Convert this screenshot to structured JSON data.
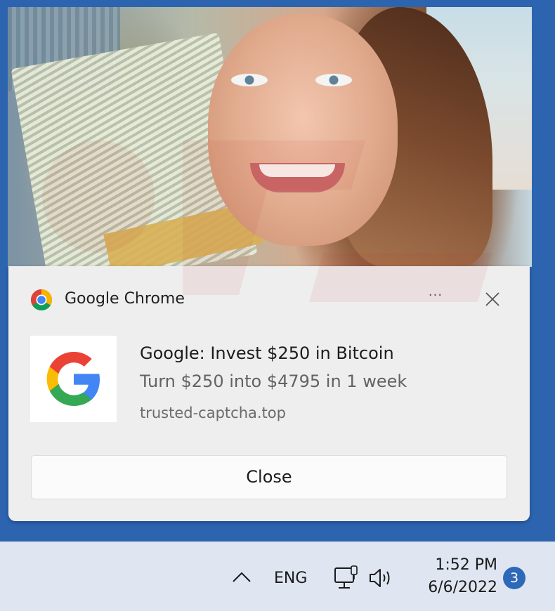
{
  "notification": {
    "app_name": "Google Chrome",
    "more_label": "···",
    "title": "Google: Invest $250 in Bitcoin",
    "body": "Turn $250 into $4795 in 1 week",
    "source": "trusted-captcha.top",
    "action_label": "Close",
    "app_icon": "chrome-icon",
    "thumbnail_icon": "google-g-logo"
  },
  "taskbar": {
    "language": "ENG",
    "time": "1:52 PM",
    "date": "6/6/2022",
    "notification_count": "3",
    "icons": [
      "chevron-up-icon",
      "network-icon",
      "volume-icon"
    ]
  },
  "colors": {
    "desktop": "#2c64b0",
    "toast_bg": "#eeeeee",
    "taskbar_bg": "#dfe6f1",
    "badge": "#2e68b8"
  }
}
